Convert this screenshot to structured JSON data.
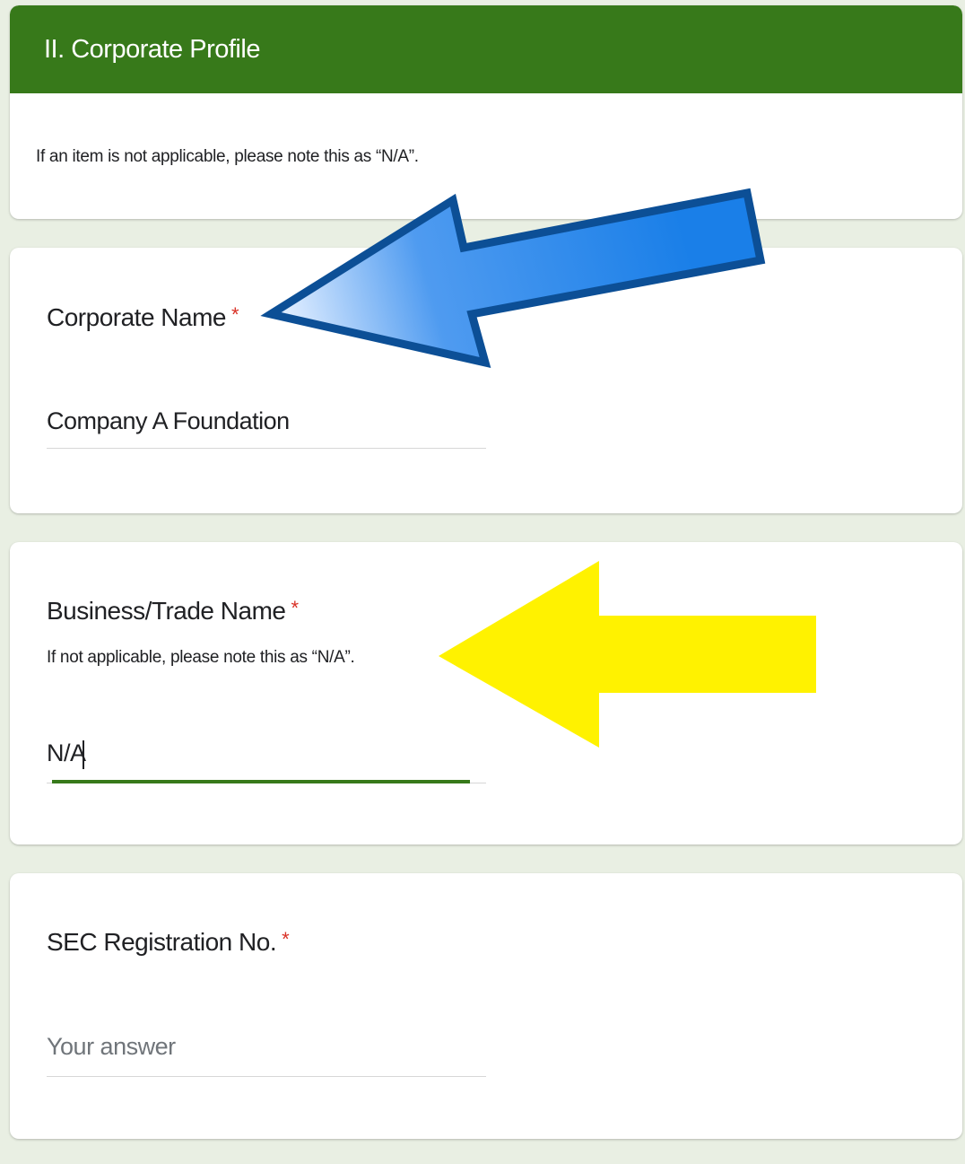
{
  "section": {
    "title": "II. Corporate Profile",
    "description": "If an item is not applicable, please note this as “N/A”."
  },
  "questions": [
    {
      "title": "Corporate Name",
      "required_mark": "*",
      "value": "Company A Foundation"
    },
    {
      "title": "Business/Trade Name",
      "required_mark": "*",
      "help": "If not applicable, please note this as “N/A”.",
      "value": "N/A"
    },
    {
      "title": "SEC Registration No.",
      "required_mark": "*",
      "placeholder": "Your answer"
    }
  ],
  "colors": {
    "header_green": "#37791a",
    "required_red": "#d93025",
    "arrow_blue": "#1a7fe8",
    "arrow_yellow": "#fff200"
  },
  "annotations": [
    "blue-arrow-icon",
    "yellow-arrow-icon"
  ]
}
